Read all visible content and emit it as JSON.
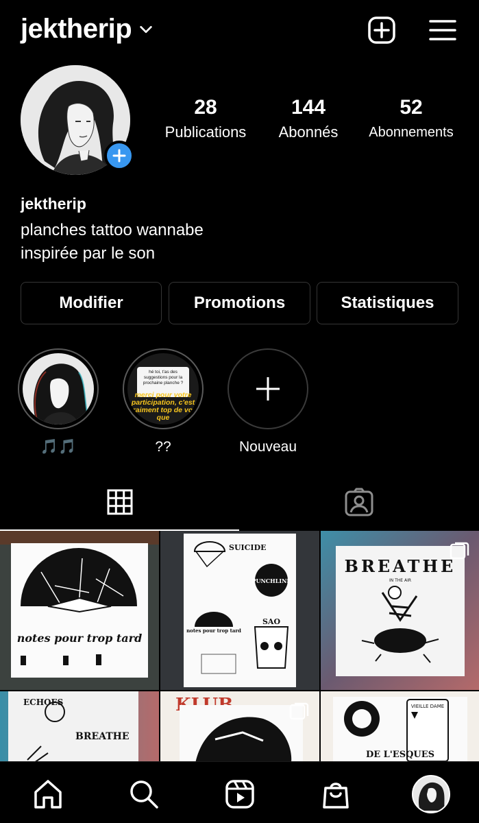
{
  "header": {
    "username": "jektherip"
  },
  "profile": {
    "stats": [
      {
        "value": "28",
        "label": "Publications"
      },
      {
        "value": "144",
        "label": "Abonnés"
      },
      {
        "value": "52",
        "label": "Abonnements"
      }
    ],
    "name": "jektherip",
    "bio_lines": [
      "planches tattoo wannabe",
      "inspirée par le son"
    ]
  },
  "actions": {
    "edit": "Modifier",
    "promotions": "Promotions",
    "statistics": "Statistiques"
  },
  "highlights": [
    {
      "label": "🎵🎵"
    },
    {
      "label": "??",
      "card_text": "hé toi, t'as des suggestions pour la prochaine planche ?",
      "overlay_text": "merci pour votre participation, c'est vraiment top de voir que"
    },
    {
      "label": "Nouveau"
    }
  ],
  "grid_text": {
    "post1": "notes pour trop tard",
    "post2_a": "SUICIDE",
    "post2_b": "PUNCHLINE",
    "post2_c": "notes pour trop tard",
    "post2_d": "SAO",
    "post3": "BREATHE",
    "post3_sub": "IN THE AIR",
    "post4": "ECHOES",
    "post4_b": "BREATHE",
    "post5": "KLUB",
    "post6": "DE L'ESQUES",
    "post6_b": "VIEILLE DAME"
  },
  "colors": {
    "background": "#000000",
    "accent": "#3897f0",
    "border": "#363636"
  }
}
